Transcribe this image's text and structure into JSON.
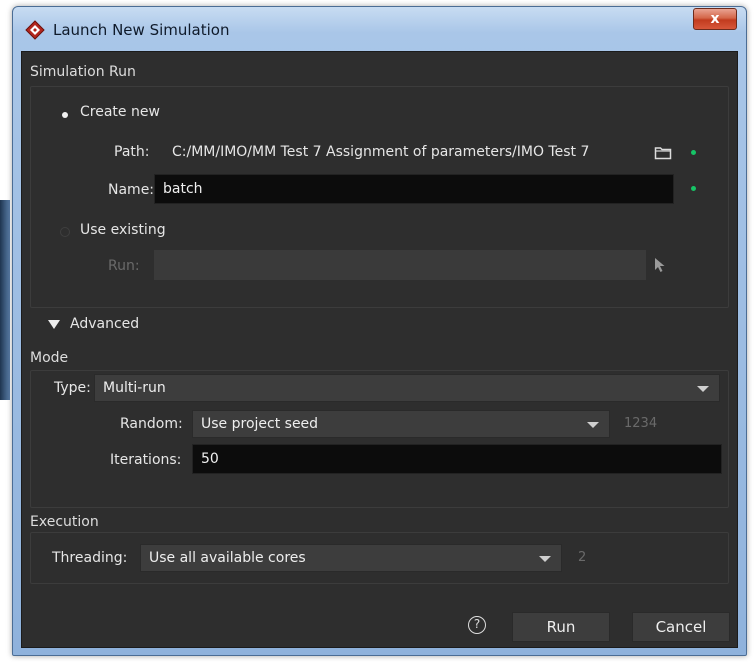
{
  "window": {
    "title": "Launch New Simulation",
    "close_label": "x"
  },
  "simulation_run": {
    "group_title": "Simulation Run",
    "create_new_label": "Create new",
    "path_label": "Path:",
    "path_value": "C:/MM/IMO/MM Test 7 Assignment of parameters/IMO Test 7",
    "name_label": "Name:",
    "name_value": "batch",
    "use_existing_label": "Use existing",
    "run_label": "Run:",
    "run_value": ""
  },
  "advanced": {
    "toggle_label": "Advanced"
  },
  "mode": {
    "group_title": "Mode",
    "type_label": "Type:",
    "type_value": "Multi-run",
    "random_label": "Random:",
    "random_value": "Use project seed",
    "seed_value": "1234",
    "iterations_label": "Iterations:",
    "iterations_value": "50"
  },
  "execution": {
    "group_title": "Execution",
    "threading_label": "Threading:",
    "threading_value": "Use all available cores",
    "cores_value": "2"
  },
  "footer": {
    "help_glyph": "?",
    "run_label": "Run",
    "cancel_label": "Cancel"
  },
  "colors": {
    "panel_bg": "#2e2e2e",
    "field_bg": "#0c0c0c",
    "status_green": "#16c466"
  }
}
